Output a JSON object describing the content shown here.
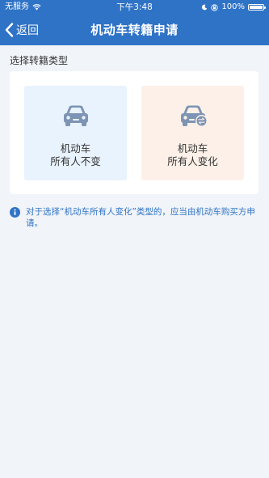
{
  "status_bar": {
    "carrier": "无服务",
    "time": "下午3:48",
    "battery_percent": "100%",
    "battery_level": 1.0
  },
  "navbar": {
    "back_label": "返回",
    "title": "机动车转籍申请"
  },
  "section": {
    "label": "选择转籍类型"
  },
  "options": [
    {
      "line1": "机动车",
      "line2": "所有人不变",
      "icon": "car-icon"
    },
    {
      "line1": "机动车",
      "line2": "所有人变化",
      "icon": "car-exchange-icon"
    }
  ],
  "notice": {
    "icon": "info-icon",
    "text": "对于选择“机动车所有人变化”类型的，应当由机动车购买方申请。"
  },
  "colors": {
    "header_bg": "#2f73c7",
    "page_bg": "#f1f4f8",
    "option_unchanged_bg": "#e9f3fd",
    "option_changed_bg": "#fcf0e8",
    "icon_color": "#7d94b4",
    "notice_text": "#2f73c7"
  }
}
